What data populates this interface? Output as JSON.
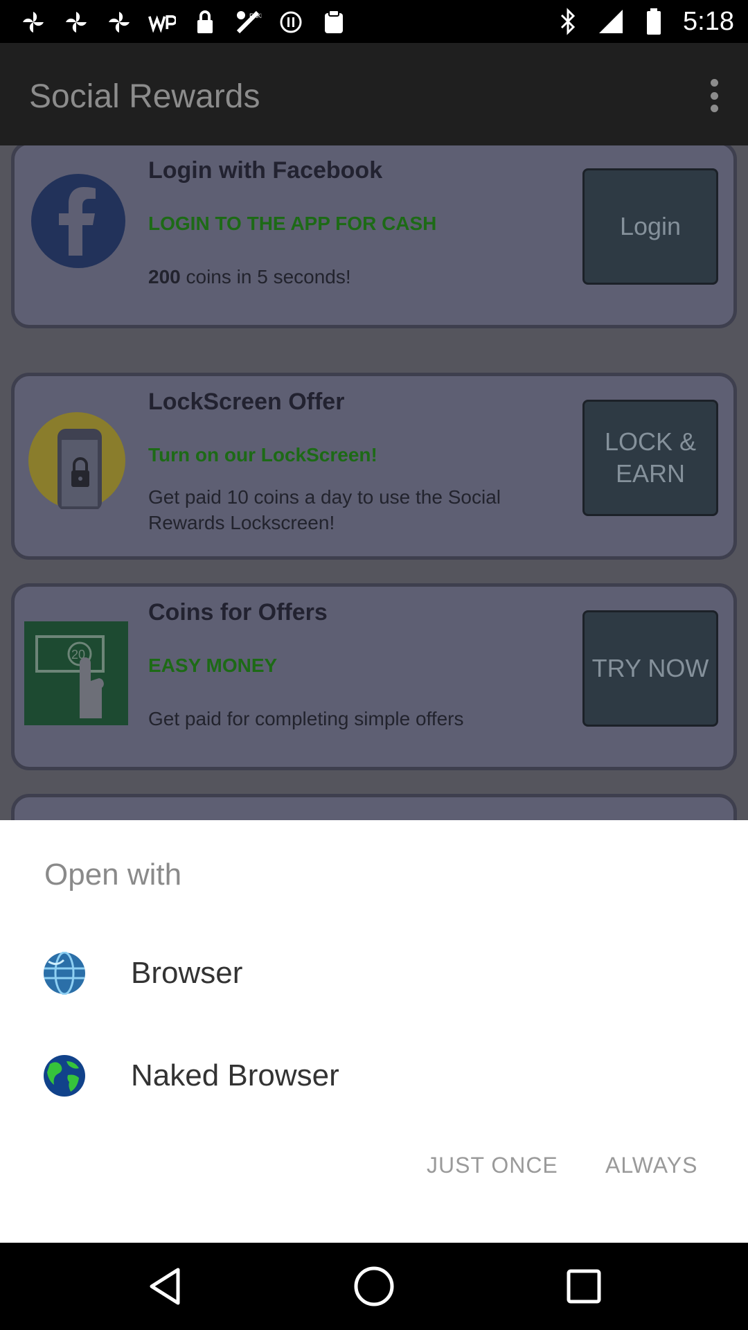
{
  "status_bar": {
    "time": "5:18",
    "left_icons": [
      "pinwheel-icon",
      "pinwheel-icon",
      "pinwheel-icon",
      "wp-icon",
      "lock-icon",
      "fake-gps-icon",
      "circle-icon",
      "clipboard-icon"
    ],
    "right_icons": [
      "bluetooth-icon",
      "signal-icon",
      "battery-icon"
    ]
  },
  "app_bar": {
    "title": "Social Rewards",
    "menu_icon": "more-vert-icon"
  },
  "cards": [
    {
      "title": "Login with Facebook",
      "subtitle": "LOGIN TO THE APP FOR CASH",
      "desc_bold": "200",
      "desc": " coins in 5 seconds!",
      "cta": "Login",
      "icon": "facebook-icon"
    },
    {
      "title": "LockScreen Offer",
      "subtitle": "Turn on our LockScreen!",
      "desc": "Get paid 10 coins a day to use the Social Rewards Lockscreen!",
      "cta": "LOCK & EARN",
      "icon": "lockscreen-icon"
    },
    {
      "title": "Coins for Offers",
      "subtitle": "EASY MONEY",
      "desc": "Get paid for completing simple offers",
      "cta": "TRY NOW",
      "icon": "cash-atm-icon"
    }
  ],
  "sheet": {
    "title": "Open with",
    "apps": [
      {
        "label": "Browser",
        "icon": "globe-icon"
      },
      {
        "label": "Naked Browser",
        "icon": "earth-icon"
      }
    ],
    "just_once": "JUST ONCE",
    "always": "ALWAYS"
  },
  "nav_bar": {
    "back": "back-icon",
    "home": "home-icon",
    "recents": "recents-icon"
  },
  "colors": {
    "subtitle_green": "#1d6a16",
    "overlay": "#55555d"
  }
}
